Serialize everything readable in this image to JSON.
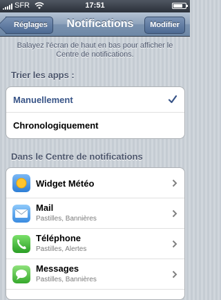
{
  "status_bar": {
    "carrier": "SFR",
    "time": "17:51",
    "battery_level": 0.8
  },
  "nav": {
    "back_label": "Réglages",
    "title": "Notifications",
    "edit_label": "Modifier"
  },
  "hint": "Balayez l'écran de haut en bas pour afficher le Centre de notifications.",
  "sort_section": {
    "header": "Trier les apps :",
    "options": [
      {
        "label": "Manuellement",
        "selected": true
      },
      {
        "label": "Chronologiquement",
        "selected": false
      }
    ]
  },
  "center_section": {
    "header": "Dans le Centre de notifications",
    "apps": [
      {
        "name": "Widget Météo",
        "subtitle": "",
        "icon": "weather-icon"
      },
      {
        "name": "Mail",
        "subtitle": "Pastilles, Bannières",
        "icon": "mail-icon"
      },
      {
        "name": "Téléphone",
        "subtitle": "Pastilles, Alertes",
        "icon": "phone-icon"
      },
      {
        "name": "Messages",
        "subtitle": "Pastilles, Bannières",
        "icon": "messages-icon"
      }
    ]
  }
}
